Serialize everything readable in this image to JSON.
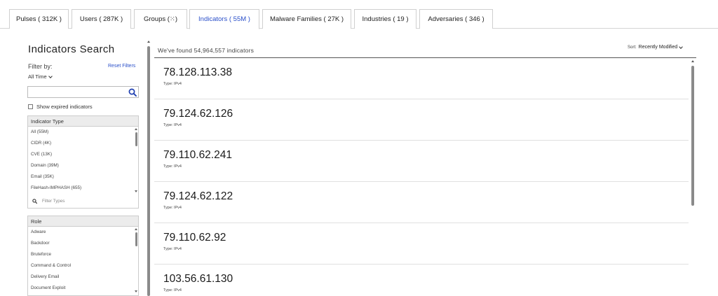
{
  "tabs": [
    {
      "label": "Pulses ( 312K )",
      "active": false
    },
    {
      "label": "Users ( 287K )",
      "active": false
    },
    {
      "label": "Groups (⁙)",
      "active": false
    },
    {
      "label": "Indicators ( 55M )",
      "active": true
    },
    {
      "label": "Malware Families ( 27K )",
      "active": false
    },
    {
      "label": "Industries ( 19 )",
      "active": false
    },
    {
      "label": "Adversaries ( 346 )",
      "active": false
    }
  ],
  "sidebar": {
    "title": "Indicators Search",
    "filter_by": "Filter by:",
    "reset_filters": "Reset Filters",
    "time_filter": "All Time",
    "search_value": "",
    "show_expired": "Show expired indicators",
    "indicator_type": {
      "header": "Indicator Type",
      "options": [
        "All (55M)",
        "CIDR (4K)",
        "CVE (13K)",
        "Domain (39M)",
        "Email (35K)",
        "FileHash-IMPHASH (655)"
      ],
      "filter_placeholder": "Filter Types"
    },
    "role": {
      "header": "Role",
      "options": [
        "Adware",
        "Backdoor",
        "Bruteforce",
        "Command & Control",
        "Delivery Email",
        "Document Exploit"
      ]
    }
  },
  "results": {
    "found_text": "We've found 54,964,557 indicators",
    "sort_label": "Sort:",
    "sort_value": "Recently Modified",
    "items": [
      {
        "ip": "78.128.113.38",
        "type": "Type: IPv4"
      },
      {
        "ip": "79.124.62.126",
        "type": "Type: IPv4"
      },
      {
        "ip": "79.110.62.241",
        "type": "Type: IPv4"
      },
      {
        "ip": "79.124.62.122",
        "type": "Type: IPv4"
      },
      {
        "ip": "79.110.62.92",
        "type": "Type: IPv4"
      },
      {
        "ip": "103.56.61.130",
        "type": "Type: IPv4"
      }
    ]
  },
  "colors": {
    "accent": "#2a4fc9",
    "border": "#cccccc",
    "scrollbar": "#8a8a8a"
  },
  "icons": {
    "search": "search-icon",
    "sort_chevron": "chevron-down-icon",
    "filter_search": "search-icon"
  }
}
